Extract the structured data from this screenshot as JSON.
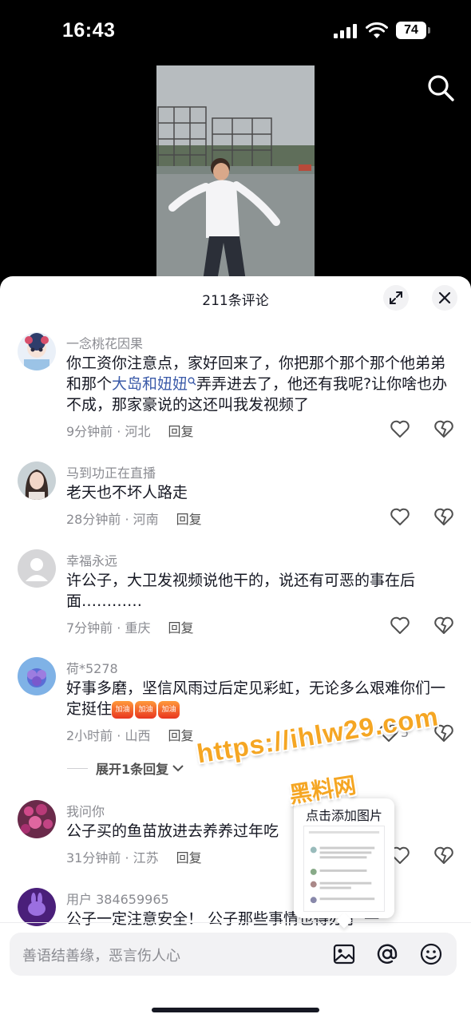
{
  "status": {
    "time": "16:43",
    "battery": "74"
  },
  "sheet": {
    "title": "211条评论"
  },
  "comments": [
    {
      "user": "一念桃花因果",
      "text_a": "你工资你注意点，家好回来了，你把那个那个那个他弟弟和那个",
      "highlight": "大岛和妞妞",
      "text_b": "弄弄进去了，他还有我呢?让你啥也办不成，那家豪说的这还叫我发视频了",
      "meta": "9分钟前 · 河北",
      "reply": "回复"
    },
    {
      "user": "马到功正在直播",
      "text": "老天也不坏人路走",
      "meta": "28分钟前 · 河南",
      "reply": "回复"
    },
    {
      "user": "幸福永远",
      "text": "许公子，大卫发视频说他干的，说还有可恶的事在后面…………",
      "meta": "7分钟前 · 重庆",
      "reply": "回复"
    },
    {
      "user": "荷*5278",
      "text": "好事多磨，坚信风雨过后定见彩虹，无论多么艰难你们一定挺住",
      "emoji_label": "加油",
      "meta": "2小时前 · 山西",
      "reply": "回复",
      "likes": "5"
    },
    {
      "user": "我问你",
      "text": "公子买的鱼苗放进去养养过年吃",
      "meta": "31分钟前 · 江苏",
      "reply": "回复"
    },
    {
      "user": "用户 384659965",
      "text": "公子一定注意安全！   公子那些事情也得办了   一"
    }
  ],
  "expand_replies": "展开1条回复",
  "input": {
    "placeholder": "善语结善缘，恶言伤人心"
  },
  "overlay": {
    "url": "https://ihlw29.com",
    "site_name": "黑料网",
    "popup_title": "点击添加图片"
  },
  "icons": {
    "search": "search-icon",
    "expand": "expand-icon",
    "close": "close-icon",
    "like": "heart-icon",
    "dislike": "broken-heart-icon",
    "image": "image-icon",
    "mention": "at-icon",
    "emoji": "emoji-icon"
  },
  "colors": {
    "highlight": "#3b5ba9",
    "watermark": "#f5a623"
  }
}
